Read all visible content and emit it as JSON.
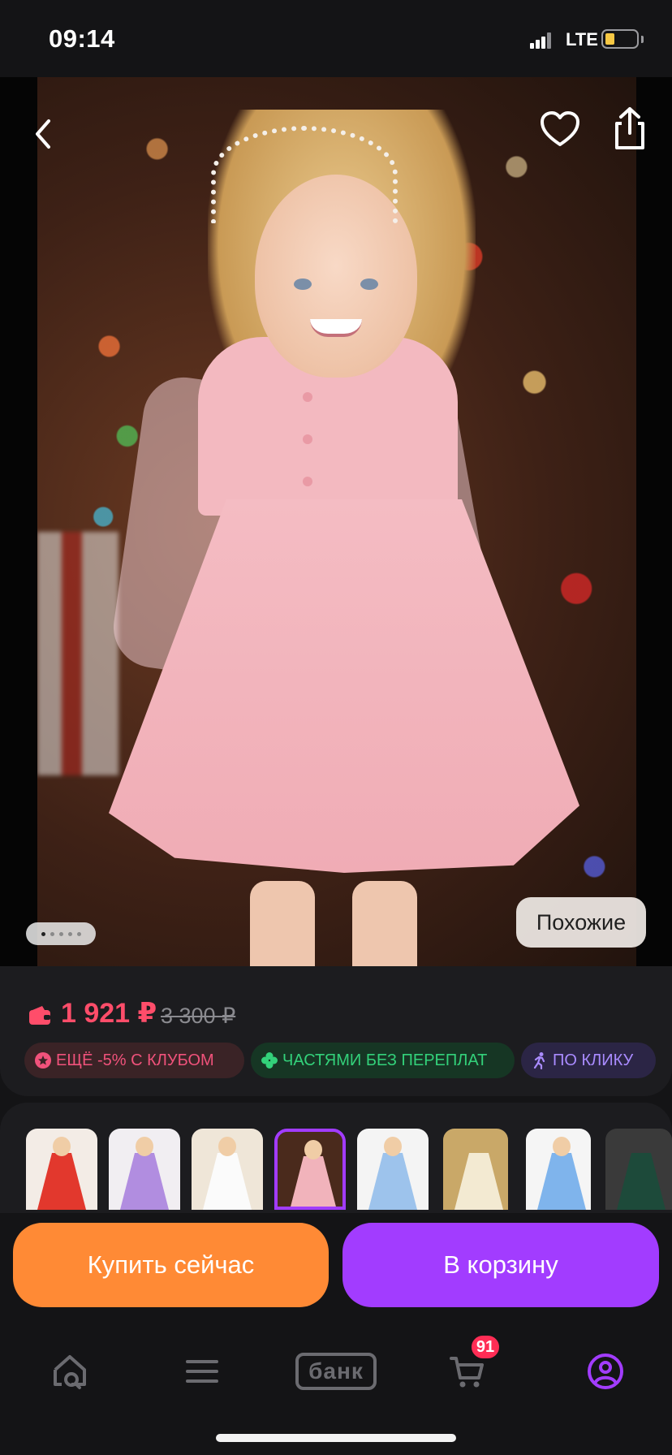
{
  "status_bar": {
    "time": "09:14",
    "network": "LTE"
  },
  "colors": {
    "accent_purple": "#a23cff",
    "accent_orange": "#ff8a35",
    "price_red": "#ff4d6a",
    "club_pink": "#f0527b",
    "parts_green": "#33d17a",
    "click_violet": "#a98bff"
  },
  "hero": {
    "icons": {
      "back": "chevron-left-icon",
      "favorite": "heart-icon",
      "share": "share-icon"
    },
    "pager": {
      "total": 5,
      "active": 0
    },
    "similar_label": "Похожие"
  },
  "price": {
    "current": "1 921 ₽",
    "old": "3 300 ₽"
  },
  "badges": [
    {
      "label": "ЕЩЁ -5% С КЛУБОМ",
      "icon": "star-badge-icon"
    },
    {
      "label": "ЧАСТЯМИ БЕЗ ПЕРЕПЛАТ",
      "icon": "clover-icon"
    },
    {
      "label": "ПО КЛИКУ",
      "icon": "running-person-icon"
    }
  ],
  "variants": [
    {
      "name": "red"
    },
    {
      "name": "lilac"
    },
    {
      "name": "white"
    },
    {
      "name": "pink",
      "selected": true
    },
    {
      "name": "light-blue"
    },
    {
      "name": "cream"
    },
    {
      "name": "blue"
    },
    {
      "name": "dark-green"
    }
  ],
  "actions": {
    "buy_now": "Купить сейчас",
    "add_to_cart": "В корзину"
  },
  "tabbar": {
    "items": [
      {
        "name": "home-search",
        "icon": "home-search-icon"
      },
      {
        "name": "catalog",
        "icon": "menu-icon"
      },
      {
        "name": "bank",
        "label": "банк"
      },
      {
        "name": "cart",
        "icon": "cart-icon",
        "badge": "91"
      },
      {
        "name": "profile",
        "icon": "profile-icon"
      }
    ]
  }
}
